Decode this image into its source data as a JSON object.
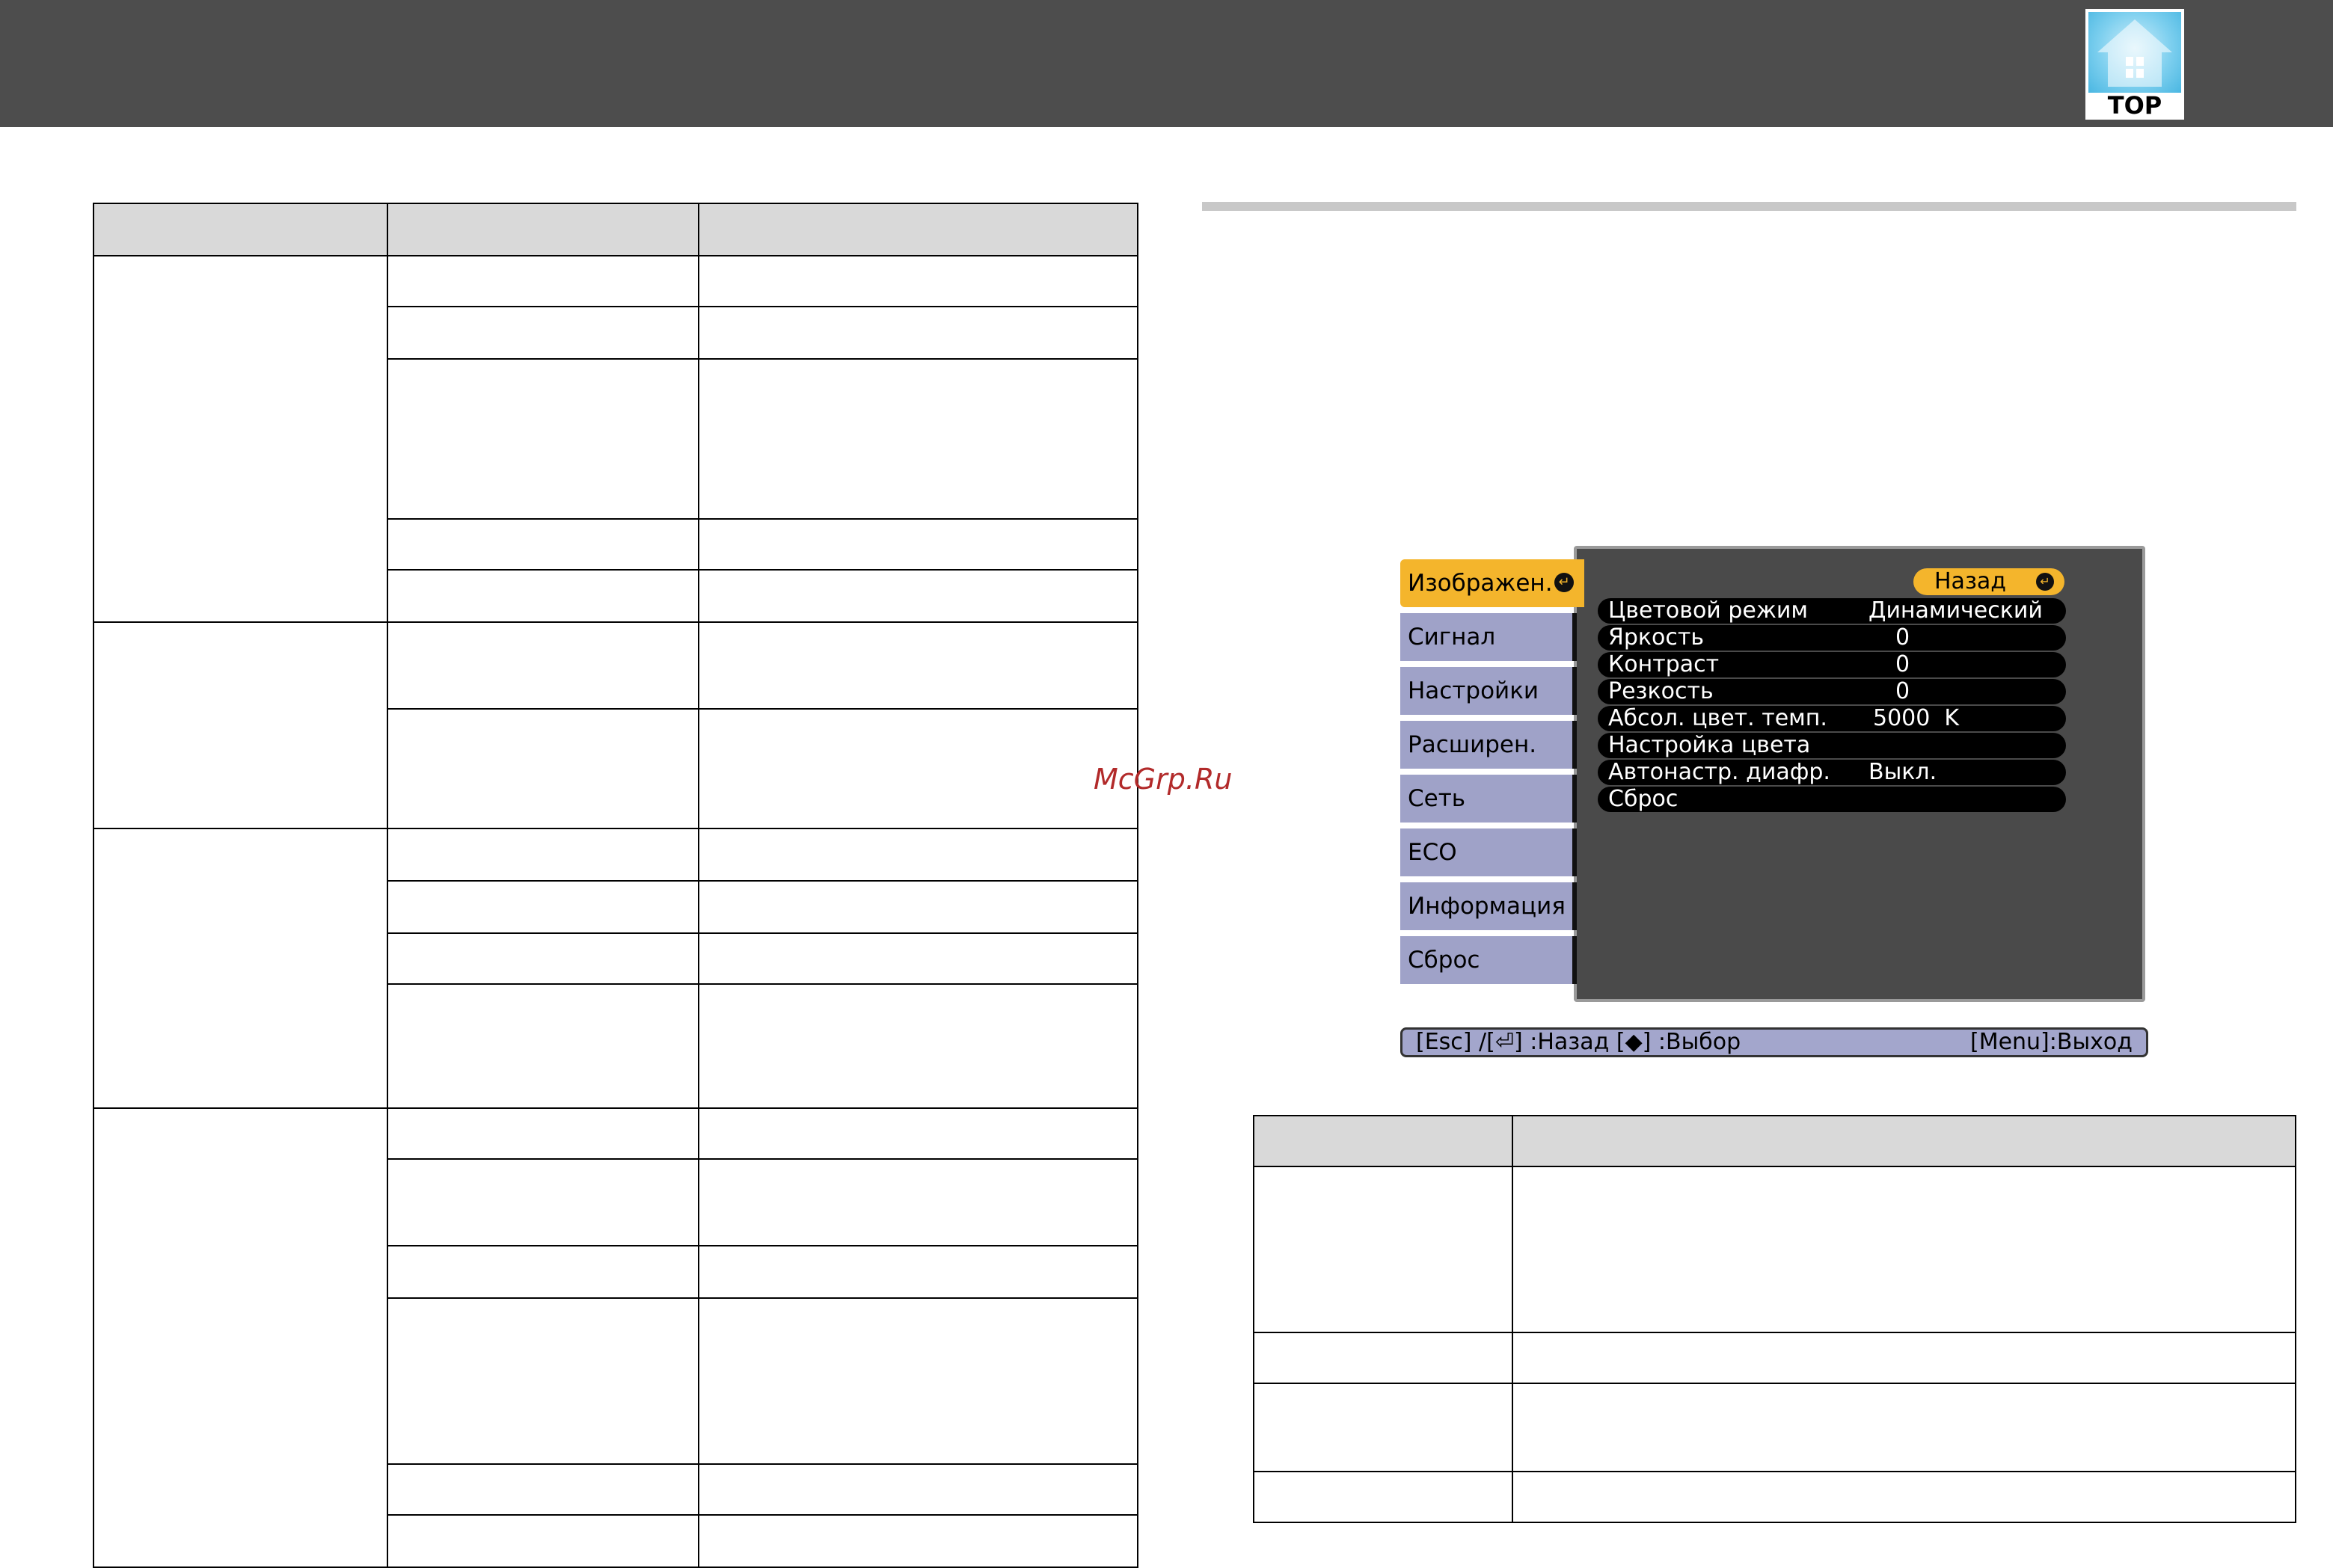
{
  "header": {
    "top_button_label": "TOP",
    "top_icon": "house-icon"
  },
  "watermark": "McGrp.Ru",
  "osd_menu": {
    "tabs": [
      {
        "label": "Изображен.",
        "active": true
      },
      {
        "label": "Сигнал",
        "active": false
      },
      {
        "label": "Настройки",
        "active": false
      },
      {
        "label": "Расширен.",
        "active": false
      },
      {
        "label": "Сеть",
        "active": false
      },
      {
        "label": "ECO",
        "active": false
      },
      {
        "label": "Информация",
        "active": false
      },
      {
        "label": "Сброс",
        "active": false
      }
    ],
    "back_button": "Назад",
    "items": [
      {
        "name": "Цветовой режим",
        "value": "Динамический"
      },
      {
        "name": "Яркость",
        "value": "0"
      },
      {
        "name": "Контраст",
        "value": "0"
      },
      {
        "name": "Резкость",
        "value": "0"
      },
      {
        "name": "Абсол. цвет. темп.",
        "value": "5000  K"
      },
      {
        "name": "Настройка цвета",
        "value": ""
      },
      {
        "name": "Автонастр. диафр.",
        "value": "Выкл."
      },
      {
        "name": "Сброс",
        "value": ""
      }
    ],
    "status_left": "[Esc] /[⏎] :Назад  [◆] :Выбор",
    "status_right": "[Menu]:Выход",
    "accent_color": "#f4b52c",
    "tab_color": "#9fa2c8"
  }
}
